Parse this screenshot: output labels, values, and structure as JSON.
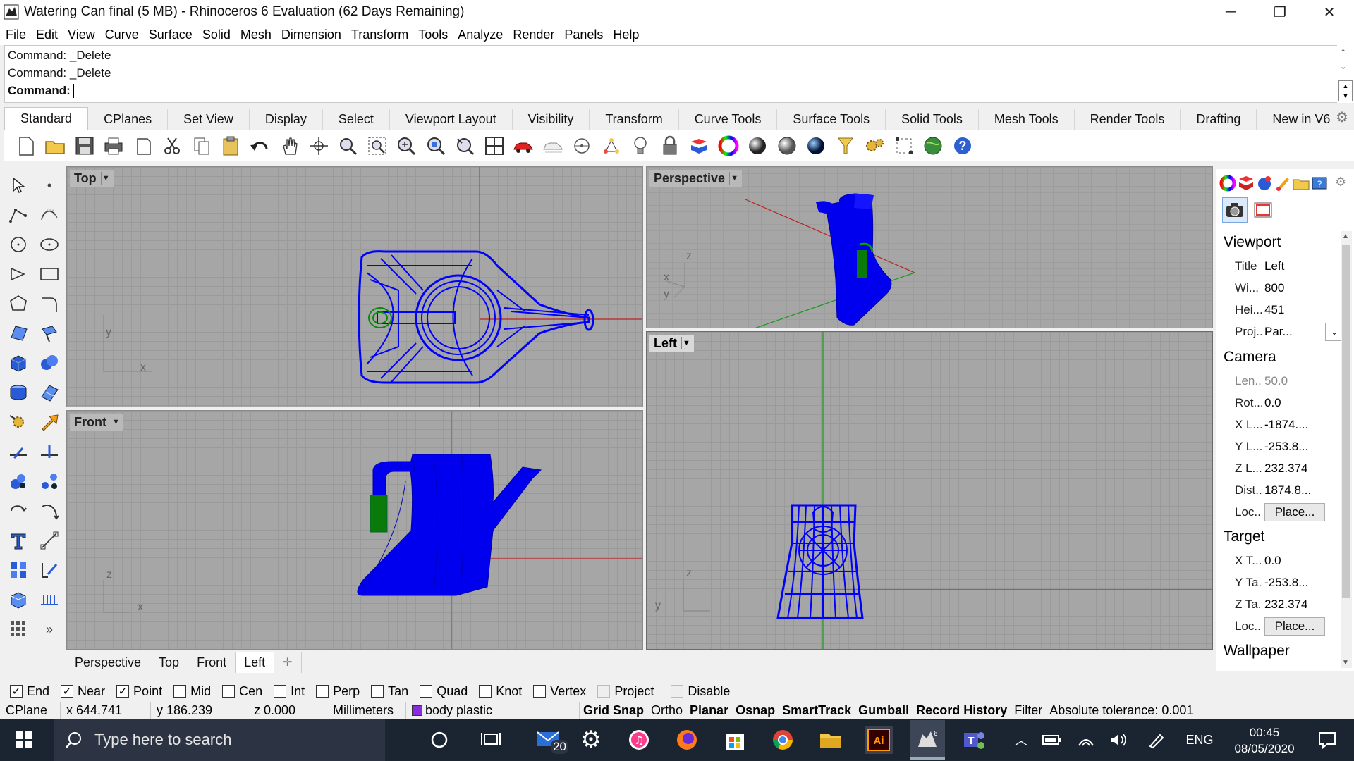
{
  "window": {
    "title": "Watering Can final (5 MB) - Rhinoceros 6 Evaluation (62 Days Remaining)",
    "minimize": "─",
    "restore": "❐",
    "close": "✕"
  },
  "menu": [
    "File",
    "Edit",
    "View",
    "Curve",
    "Surface",
    "Solid",
    "Mesh",
    "Dimension",
    "Transform",
    "Tools",
    "Analyze",
    "Render",
    "Panels",
    "Help"
  ],
  "command": {
    "history": [
      "Command: _Delete",
      "Command: _Delete"
    ],
    "prompt": "Command:",
    "value": ""
  },
  "tabs": [
    "Standard",
    "CPlanes",
    "Set View",
    "Display",
    "Select",
    "Viewport Layout",
    "Visibility",
    "Transform",
    "Curve Tools",
    "Surface Tools",
    "Solid Tools",
    "Mesh Tools",
    "Render Tools",
    "Drafting",
    "New in V6"
  ],
  "viewports": {
    "top": {
      "label": "Top",
      "axes": {
        "y": "y",
        "x": "x"
      }
    },
    "perspective": {
      "label": "Perspective",
      "axes": {
        "z": "z",
        "x": "x",
        "y": "y"
      }
    },
    "front": {
      "label": "Front",
      "axes": {
        "z": "z",
        "x": "x"
      }
    },
    "left": {
      "label": "Left",
      "axes": {
        "z": "z",
        "y": "y"
      }
    }
  },
  "viewport_tabs": [
    "Perspective",
    "Top",
    "Front",
    "Left"
  ],
  "panel": {
    "viewport_header": "Viewport",
    "viewport_rows": [
      {
        "k": "Title",
        "v": "Left"
      },
      {
        "k": "Wi...",
        "v": "800"
      },
      {
        "k": "Hei...",
        "v": "451"
      },
      {
        "k": "Proj...",
        "v": "Par..."
      }
    ],
    "camera_header": "Camera",
    "camera_rows": [
      {
        "k": "Len...",
        "v": "50.0"
      },
      {
        "k": "Rot...",
        "v": "0.0"
      },
      {
        "k": "X L...",
        "v": "-1874...."
      },
      {
        "k": "Y L...",
        "v": "-253.8..."
      },
      {
        "k": "Z L...",
        "v": "232.374"
      },
      {
        "k": "Dist...",
        "v": "1874.8..."
      },
      {
        "k": "Loc...",
        "v": "Place..."
      }
    ],
    "target_header": "Target",
    "target_rows": [
      {
        "k": "X T...",
        "v": "0.0"
      },
      {
        "k": "Y Ta...",
        "v": "-253.8..."
      },
      {
        "k": "Z Ta...",
        "v": "232.374"
      },
      {
        "k": "Loc...",
        "v": "Place..."
      }
    ],
    "wallpaper_header": "Wallpaper"
  },
  "osnaps": [
    {
      "label": "End",
      "checked": true
    },
    {
      "label": "Near",
      "checked": true
    },
    {
      "label": "Point",
      "checked": true
    },
    {
      "label": "Mid",
      "checked": false
    },
    {
      "label": "Cen",
      "checked": false
    },
    {
      "label": "Int",
      "checked": false
    },
    {
      "label": "Perp",
      "checked": false
    },
    {
      "label": "Tan",
      "checked": false
    },
    {
      "label": "Quad",
      "checked": false
    },
    {
      "label": "Knot",
      "checked": false
    },
    {
      "label": "Vertex",
      "checked": false
    },
    {
      "label": "Project",
      "checked": false,
      "disabled": true
    },
    {
      "label": "Disable",
      "checked": false,
      "disabled": true
    }
  ],
  "status": {
    "cplane": "CPlane",
    "x": "x 644.741",
    "y": "y 186.239",
    "z": "z 0.000",
    "units": "Millimeters",
    "layer": "body plastic",
    "layer_color": "#8a2be2",
    "grid_snap": "Grid Snap",
    "ortho": "Ortho",
    "planar": "Planar",
    "osnap": "Osnap",
    "smarttrack": "SmartTrack",
    "gumball": "Gumball",
    "record_history": "Record History",
    "filter": "Filter",
    "tolerance": "Absolute tolerance: 0.001"
  },
  "taskbar": {
    "search_placeholder": "Type here to search",
    "mail_badge": "20",
    "time": "00:45",
    "date": "08/05/2020",
    "lang": "ENG"
  },
  "colors": {
    "model_blue": "#0000ff",
    "handle_green": "#0a7a0a",
    "viewport_bg": "#a6a6a6",
    "taskbar": "#1b2431"
  }
}
